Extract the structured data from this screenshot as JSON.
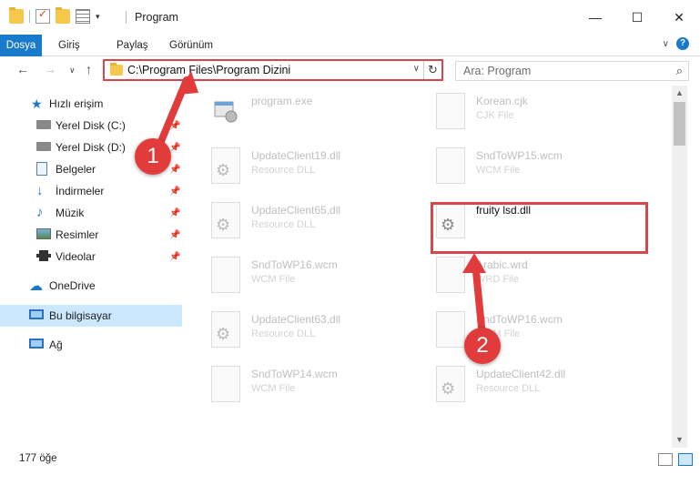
{
  "window": {
    "title": "Program",
    "minimize_glyph": "—",
    "maximize_glyph": "☐",
    "close_glyph": "✕"
  },
  "ribbon": {
    "tabs": [
      "Dosya",
      "Giriş",
      "Paylaş",
      "Görünüm"
    ],
    "file_tab_color": "#1979ca"
  },
  "address": {
    "path": "C:\\Program Files\\Program Dizini",
    "search_placeholder": "Ara: Program"
  },
  "nav": {
    "items": [
      {
        "label": "Hızlı erişim",
        "icon": "star-icon",
        "pinned": false
      },
      {
        "label": "Yerel Disk (C:)",
        "icon": "drive-icon",
        "pinned": true
      },
      {
        "label": "Yerel Disk (D:)",
        "icon": "drive-icon",
        "pinned": true
      },
      {
        "label": "Belgeler",
        "icon": "documents-icon",
        "pinned": true
      },
      {
        "label": "İndirmeler",
        "icon": "download-icon",
        "pinned": true
      },
      {
        "label": "Müzik",
        "icon": "music-icon",
        "pinned": true
      },
      {
        "label": "Resimler",
        "icon": "pictures-icon",
        "pinned": true
      },
      {
        "label": "Videolar",
        "icon": "video-icon",
        "pinned": true
      },
      {
        "label": "OneDrive",
        "icon": "cloud-icon",
        "pinned": false
      },
      {
        "label": "Bu bilgisayar",
        "icon": "computer-icon",
        "pinned": false,
        "selected": true
      },
      {
        "label": "Ağ",
        "icon": "network-icon",
        "pinned": false
      }
    ]
  },
  "files": [
    {
      "name": "program.exe",
      "type": "",
      "kind": "exe"
    },
    {
      "name": "Korean.cjk",
      "type": "CJK File",
      "kind": "doc"
    },
    {
      "name": "UpdateClient19.dll",
      "type": "Resource DLL",
      "kind": "dll"
    },
    {
      "name": "SndToWP15.wcm",
      "type": "WCM File",
      "kind": "doc"
    },
    {
      "name": "UpdateClient65.dll",
      "type": "Resource DLL",
      "kind": "dll"
    },
    {
      "name": "fruity lsd.dll",
      "type": "",
      "kind": "dll",
      "highlight": true
    },
    {
      "name": "SndToWP16.wcm",
      "type": "WCM File",
      "kind": "doc"
    },
    {
      "name": "Arabic.wrd",
      "type": "WRD File",
      "kind": "doc"
    },
    {
      "name": "UpdateClient63.dll",
      "type": "Resource DLL",
      "kind": "dll"
    },
    {
      "name": "SndToWP16.wcm",
      "type": "WCM File",
      "kind": "doc"
    },
    {
      "name": "SndToWP14.wcm",
      "type": "WCM File",
      "kind": "doc"
    },
    {
      "name": "UpdateClient42.dll",
      "type": "Resource DLL",
      "kind": "dll"
    }
  ],
  "status": {
    "item_count": "177 öğe"
  },
  "annotations": {
    "step1": "1",
    "step2": "2",
    "color": "#e23b3b"
  }
}
